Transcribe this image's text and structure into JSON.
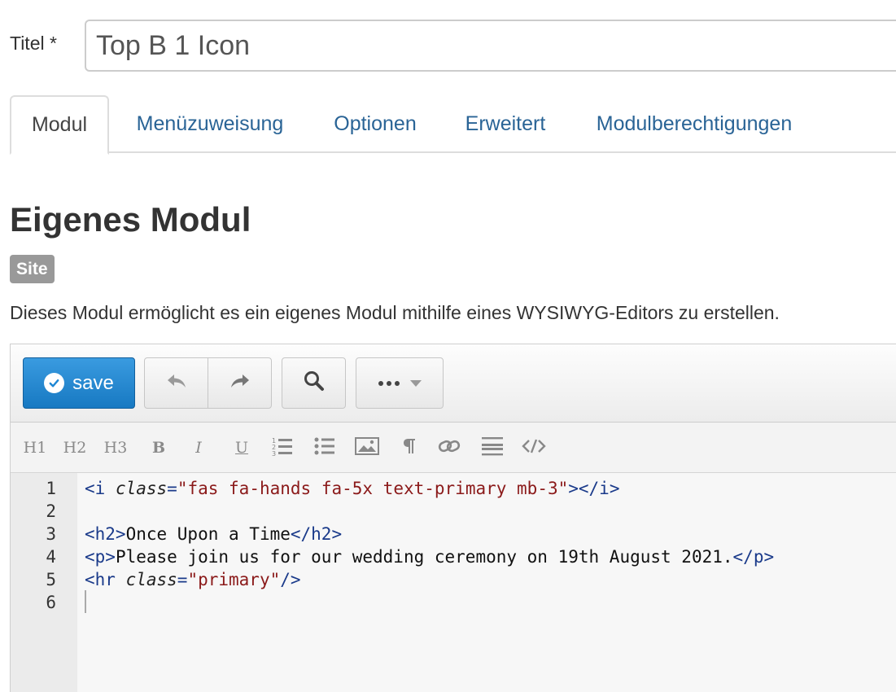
{
  "title_field": {
    "label": "Titel *",
    "value": "Top B 1 Icon"
  },
  "tabs": [
    {
      "label": "Modul",
      "active": true
    },
    {
      "label": "Menüzuweisung",
      "active": false
    },
    {
      "label": "Optionen",
      "active": false
    },
    {
      "label": "Erweitert",
      "active": false
    },
    {
      "label": "Modulberechtigungen",
      "active": false
    }
  ],
  "module": {
    "title": "Eigenes Modul",
    "badge": "Site",
    "description": "Dieses Modul ermöglicht es ein eigenes Modul mithilfe eines WYSIWYG-Editors zu erstellen."
  },
  "editor": {
    "toolbar": {
      "save_label": "save",
      "buttons": [
        "check-circle-icon",
        "undo-icon",
        "redo-icon",
        "search-icon",
        "more-icon",
        "caret-down-icon"
      ]
    },
    "format_toolbar": [
      "H1",
      "H2",
      "H3",
      "B",
      "I",
      "U"
    ],
    "format_icons": [
      "ordered-list-icon",
      "unordered-list-icon",
      "image-icon",
      "paragraph-icon",
      "link-icon",
      "horizontal-rule-icon",
      "code-icon"
    ],
    "lines": [
      {
        "n": "1",
        "segments": [
          {
            "t": "<i ",
            "c": "tag"
          },
          {
            "t": "class",
            "c": "attr"
          },
          {
            "t": "=",
            "c": "eq"
          },
          {
            "t": "\"fas fa-hands fa-5x text-primary mb-3\"",
            "c": "str"
          },
          {
            "t": "></i>",
            "c": "tag"
          }
        ]
      },
      {
        "n": "2",
        "segments": []
      },
      {
        "n": "3",
        "segments": [
          {
            "t": "<h2>",
            "c": "tag"
          },
          {
            "t": "Once Upon a Time",
            "c": "txt"
          },
          {
            "t": "</h2>",
            "c": "tag"
          }
        ]
      },
      {
        "n": "4",
        "segments": [
          {
            "t": "<p>",
            "c": "tag"
          },
          {
            "t": "Please join us for our wedding ceremony on 19th August 2021.",
            "c": "txt"
          },
          {
            "t": "</p>",
            "c": "tag"
          }
        ]
      },
      {
        "n": "5",
        "segments": [
          {
            "t": "<hr ",
            "c": "tag"
          },
          {
            "t": "class",
            "c": "attr"
          },
          {
            "t": "=",
            "c": "eq"
          },
          {
            "t": "\"primary\"",
            "c": "str"
          },
          {
            "t": "/>",
            "c": "tag"
          }
        ]
      },
      {
        "n": "6",
        "segments": []
      }
    ]
  },
  "colors": {
    "link": "#2a6496",
    "save_button": "#1e87d4",
    "badge": "#999999"
  }
}
